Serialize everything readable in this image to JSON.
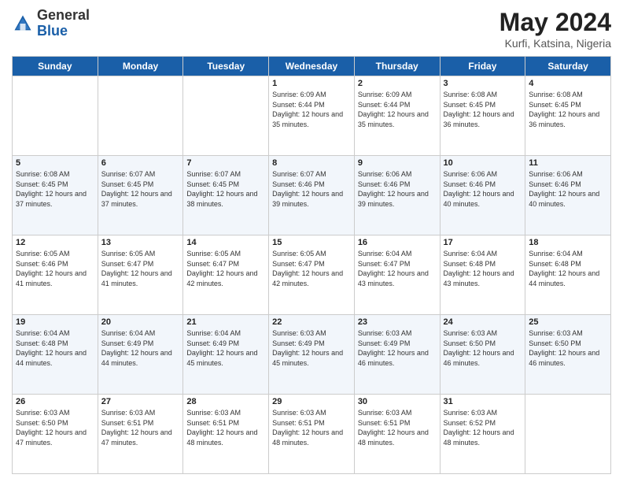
{
  "header": {
    "logo_general": "General",
    "logo_blue": "Blue",
    "title": "May 2024",
    "location": "Kurfi, Katsina, Nigeria"
  },
  "days_of_week": [
    "Sunday",
    "Monday",
    "Tuesday",
    "Wednesday",
    "Thursday",
    "Friday",
    "Saturday"
  ],
  "weeks": [
    [
      {
        "day": "",
        "sunrise": "",
        "sunset": "",
        "daylight": ""
      },
      {
        "day": "",
        "sunrise": "",
        "sunset": "",
        "daylight": ""
      },
      {
        "day": "",
        "sunrise": "",
        "sunset": "",
        "daylight": ""
      },
      {
        "day": "1",
        "sunrise": "Sunrise: 6:09 AM",
        "sunset": "Sunset: 6:44 PM",
        "daylight": "Daylight: 12 hours and 35 minutes."
      },
      {
        "day": "2",
        "sunrise": "Sunrise: 6:09 AM",
        "sunset": "Sunset: 6:44 PM",
        "daylight": "Daylight: 12 hours and 35 minutes."
      },
      {
        "day": "3",
        "sunrise": "Sunrise: 6:08 AM",
        "sunset": "Sunset: 6:45 PM",
        "daylight": "Daylight: 12 hours and 36 minutes."
      },
      {
        "day": "4",
        "sunrise": "Sunrise: 6:08 AM",
        "sunset": "Sunset: 6:45 PM",
        "daylight": "Daylight: 12 hours and 36 minutes."
      }
    ],
    [
      {
        "day": "5",
        "sunrise": "Sunrise: 6:08 AM",
        "sunset": "Sunset: 6:45 PM",
        "daylight": "Daylight: 12 hours and 37 minutes."
      },
      {
        "day": "6",
        "sunrise": "Sunrise: 6:07 AM",
        "sunset": "Sunset: 6:45 PM",
        "daylight": "Daylight: 12 hours and 37 minutes."
      },
      {
        "day": "7",
        "sunrise": "Sunrise: 6:07 AM",
        "sunset": "Sunset: 6:45 PM",
        "daylight": "Daylight: 12 hours and 38 minutes."
      },
      {
        "day": "8",
        "sunrise": "Sunrise: 6:07 AM",
        "sunset": "Sunset: 6:46 PM",
        "daylight": "Daylight: 12 hours and 39 minutes."
      },
      {
        "day": "9",
        "sunrise": "Sunrise: 6:06 AM",
        "sunset": "Sunset: 6:46 PM",
        "daylight": "Daylight: 12 hours and 39 minutes."
      },
      {
        "day": "10",
        "sunrise": "Sunrise: 6:06 AM",
        "sunset": "Sunset: 6:46 PM",
        "daylight": "Daylight: 12 hours and 40 minutes."
      },
      {
        "day": "11",
        "sunrise": "Sunrise: 6:06 AM",
        "sunset": "Sunset: 6:46 PM",
        "daylight": "Daylight: 12 hours and 40 minutes."
      }
    ],
    [
      {
        "day": "12",
        "sunrise": "Sunrise: 6:05 AM",
        "sunset": "Sunset: 6:46 PM",
        "daylight": "Daylight: 12 hours and 41 minutes."
      },
      {
        "day": "13",
        "sunrise": "Sunrise: 6:05 AM",
        "sunset": "Sunset: 6:47 PM",
        "daylight": "Daylight: 12 hours and 41 minutes."
      },
      {
        "day": "14",
        "sunrise": "Sunrise: 6:05 AM",
        "sunset": "Sunset: 6:47 PM",
        "daylight": "Daylight: 12 hours and 42 minutes."
      },
      {
        "day": "15",
        "sunrise": "Sunrise: 6:05 AM",
        "sunset": "Sunset: 6:47 PM",
        "daylight": "Daylight: 12 hours and 42 minutes."
      },
      {
        "day": "16",
        "sunrise": "Sunrise: 6:04 AM",
        "sunset": "Sunset: 6:47 PM",
        "daylight": "Daylight: 12 hours and 43 minutes."
      },
      {
        "day": "17",
        "sunrise": "Sunrise: 6:04 AM",
        "sunset": "Sunset: 6:48 PM",
        "daylight": "Daylight: 12 hours and 43 minutes."
      },
      {
        "day": "18",
        "sunrise": "Sunrise: 6:04 AM",
        "sunset": "Sunset: 6:48 PM",
        "daylight": "Daylight: 12 hours and 44 minutes."
      }
    ],
    [
      {
        "day": "19",
        "sunrise": "Sunrise: 6:04 AM",
        "sunset": "Sunset: 6:48 PM",
        "daylight": "Daylight: 12 hours and 44 minutes."
      },
      {
        "day": "20",
        "sunrise": "Sunrise: 6:04 AM",
        "sunset": "Sunset: 6:49 PM",
        "daylight": "Daylight: 12 hours and 44 minutes."
      },
      {
        "day": "21",
        "sunrise": "Sunrise: 6:04 AM",
        "sunset": "Sunset: 6:49 PM",
        "daylight": "Daylight: 12 hours and 45 minutes."
      },
      {
        "day": "22",
        "sunrise": "Sunrise: 6:03 AM",
        "sunset": "Sunset: 6:49 PM",
        "daylight": "Daylight: 12 hours and 45 minutes."
      },
      {
        "day": "23",
        "sunrise": "Sunrise: 6:03 AM",
        "sunset": "Sunset: 6:49 PM",
        "daylight": "Daylight: 12 hours and 46 minutes."
      },
      {
        "day": "24",
        "sunrise": "Sunrise: 6:03 AM",
        "sunset": "Sunset: 6:50 PM",
        "daylight": "Daylight: 12 hours and 46 minutes."
      },
      {
        "day": "25",
        "sunrise": "Sunrise: 6:03 AM",
        "sunset": "Sunset: 6:50 PM",
        "daylight": "Daylight: 12 hours and 46 minutes."
      }
    ],
    [
      {
        "day": "26",
        "sunrise": "Sunrise: 6:03 AM",
        "sunset": "Sunset: 6:50 PM",
        "daylight": "Daylight: 12 hours and 47 minutes."
      },
      {
        "day": "27",
        "sunrise": "Sunrise: 6:03 AM",
        "sunset": "Sunset: 6:51 PM",
        "daylight": "Daylight: 12 hours and 47 minutes."
      },
      {
        "day": "28",
        "sunrise": "Sunrise: 6:03 AM",
        "sunset": "Sunset: 6:51 PM",
        "daylight": "Daylight: 12 hours and 48 minutes."
      },
      {
        "day": "29",
        "sunrise": "Sunrise: 6:03 AM",
        "sunset": "Sunset: 6:51 PM",
        "daylight": "Daylight: 12 hours and 48 minutes."
      },
      {
        "day": "30",
        "sunrise": "Sunrise: 6:03 AM",
        "sunset": "Sunset: 6:51 PM",
        "daylight": "Daylight: 12 hours and 48 minutes."
      },
      {
        "day": "31",
        "sunrise": "Sunrise: 6:03 AM",
        "sunset": "Sunset: 6:52 PM",
        "daylight": "Daylight: 12 hours and 48 minutes."
      },
      {
        "day": "",
        "sunrise": "",
        "sunset": "",
        "daylight": ""
      }
    ]
  ]
}
